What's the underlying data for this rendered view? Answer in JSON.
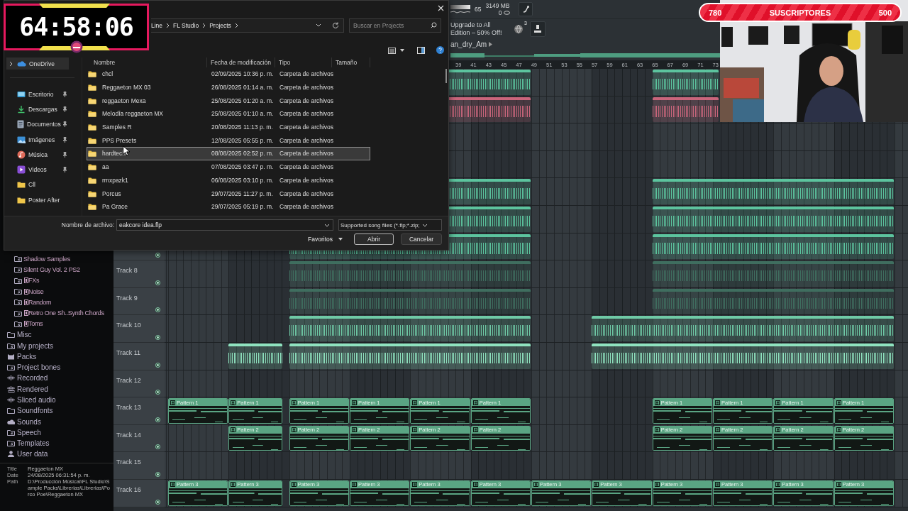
{
  "timer": {
    "time": "64:58:06"
  },
  "subscriber_goal": {
    "left_count": "780",
    "label": "SUSCRIPTORES",
    "right_count": "500"
  },
  "toolbar": {
    "cpu": "65",
    "memory": "3149 MB",
    "polyphony": "0",
    "upgrade_notice": "Upgrade to All Edition – 50% Off!",
    "notification_count": "3",
    "pattern": "an_dry_Am"
  },
  "ruler": [
    "39",
    "41",
    "43",
    "45",
    "47",
    "49",
    "51",
    "53",
    "55",
    "57",
    "59",
    "61",
    "63",
    "65",
    "67",
    "69",
    "71",
    "73"
  ],
  "tracks": [
    {
      "color": "#5cc49e",
      "clips": [
        {
          "kind": "audio"
        },
        {
          "kind": "audio"
        }
      ]
    },
    {
      "color": "#c9657b",
      "clips": [
        {
          "kind": "audio"
        },
        {
          "kind": "audio"
        }
      ]
    },
    {
      "color": "#5cc49e",
      "clips": [
        {
          "kind": "audio"
        },
        {
          "kind": "audio"
        }
      ]
    },
    {
      "color": "#5cc49e",
      "clips": [
        {
          "kind": "audio"
        },
        {
          "kind": "audio"
        }
      ]
    },
    {
      "color": "#5cc49e",
      "clips": [
        {
          "kind": "audio"
        },
        {
          "kind": "audio"
        }
      ]
    },
    {
      "name": "Track 8",
      "color": "#3f6e5f",
      "clips": [
        {
          "kind": "audio"
        },
        {
          "kind": "audio"
        }
      ]
    },
    {
      "name": "Track 9",
      "color": "#3f6e5f",
      "clips": [
        {
          "kind": "audio"
        },
        {
          "kind": "audio"
        }
      ]
    },
    {
      "name": "Track 10",
      "color": "#6fcaa6",
      "clips": [
        {
          "kind": "audio"
        },
        {
          "kind": "audio"
        }
      ]
    },
    {
      "name": "Track 11",
      "color": "#8fe3bf",
      "clips": [
        {
          "kind": "audio"
        },
        {
          "kind": "audio"
        },
        {
          "kind": "audio"
        }
      ]
    },
    {
      "name": "Track 12"
    },
    {
      "name": "Track 13",
      "color": "#5aa583",
      "clips": [
        {
          "kind": "pattern",
          "label": "Pattern 1"
        },
        {
          "kind": "pattern",
          "label": "Pattern 1"
        },
        {
          "kind": "pattern",
          "label": "Pattern 1"
        },
        {
          "kind": "pattern",
          "label": "Pattern 1"
        },
        {
          "kind": "pattern",
          "label": "Pattern 1"
        },
        {
          "kind": "pattern",
          "label": "Pattern 1"
        },
        {
          "kind": "pattern",
          "label": "Pattern 1"
        },
        {
          "kind": "pattern",
          "label": "Pattern 1"
        },
        {
          "kind": "pattern",
          "label": "Pattern 1"
        },
        {
          "kind": "pattern",
          "label": "Pattern 1"
        }
      ]
    },
    {
      "name": "Track 14",
      "color": "#5aa583",
      "clips": [
        {
          "kind": "pattern",
          "label": "Pattern 2"
        },
        {
          "kind": "pattern",
          "label": "Pattern 2"
        },
        {
          "kind": "pattern",
          "label": "Pattern 2"
        },
        {
          "kind": "pattern",
          "label": "Pattern 2"
        },
        {
          "kind": "pattern",
          "label": "Pattern 2"
        },
        {
          "kind": "pattern",
          "label": "Pattern 2"
        },
        {
          "kind": "pattern",
          "label": "Pattern 2"
        },
        {
          "kind": "pattern",
          "label": "Pattern 2"
        },
        {
          "kind": "pattern",
          "label": "Pattern 2"
        }
      ]
    },
    {
      "name": "Track 15"
    },
    {
      "name": "Track 16",
      "color": "#5aa583",
      "clips": [
        {
          "kind": "pattern",
          "label": "Pattern 3"
        },
        {
          "kind": "pattern",
          "label": "Pattern 3"
        },
        {
          "kind": "pattern",
          "label": "Pattern 3"
        },
        {
          "kind": "pattern",
          "label": "Pattern 3"
        },
        {
          "kind": "pattern",
          "label": "Pattern 3"
        },
        {
          "kind": "pattern",
          "label": "Pattern 3"
        },
        {
          "kind": "pattern",
          "label": "Pattern 3"
        },
        {
          "kind": "pattern",
          "label": "Pattern 3"
        },
        {
          "kind": "pattern",
          "label": "Pattern 3"
        },
        {
          "kind": "pattern",
          "label": "Pattern 3"
        },
        {
          "kind": "pattern",
          "label": "Pattern 3"
        },
        {
          "kind": "pattern",
          "label": "Pattern 3"
        }
      ]
    }
  ],
  "browser": {
    "items": [
      {
        "children": [
          {
            "label": "Shadow Samples",
            "kind": "link-folder"
          },
          {
            "label": "Silent Guy Vol. 2 PS2",
            "kind": "link-folder"
          },
          {
            "label": "FXs",
            "kind": "boxed-folder"
          },
          {
            "label": "Noise",
            "kind": "boxed-folder"
          },
          {
            "label": "Random",
            "kind": "boxed-folder"
          },
          {
            "label": "Retro One Sh..Synth Chords",
            "kind": "boxed-folder"
          },
          {
            "label": "Toms",
            "kind": "boxed-folder"
          }
        ]
      },
      {
        "label": "Misc",
        "kind": "folder"
      },
      {
        "label": "My projects",
        "kind": "link-folder"
      },
      {
        "label": "Packs",
        "kind": "pack"
      },
      {
        "label": "Project bones",
        "kind": "link-folder"
      },
      {
        "label": "Recorded",
        "kind": "audio"
      },
      {
        "label": "Rendered",
        "kind": "rendered"
      },
      {
        "label": "Sliced audio",
        "kind": "audio"
      },
      {
        "label": "Soundfonts",
        "kind": "folder"
      },
      {
        "label": "Sounds",
        "kind": "cloud"
      },
      {
        "label": "Speech",
        "kind": "link-folder"
      },
      {
        "label": "Templates",
        "kind": "link-folder"
      },
      {
        "label": "User data",
        "kind": "user"
      }
    ],
    "info": [
      {
        "label": "Title",
        "value": "Reggaeton MX"
      },
      {
        "label": "Date",
        "value": "24/08/2025 06:31:54 p. m."
      },
      {
        "label": "Path",
        "value": "D:\\Producción Músical\\FL Studio\\Sample Packs\\Librerias\\Librerias\\Porco Poe\\Reggaeton MX"
      }
    ]
  },
  "dialog": {
    "breadcrumb": [
      "Line",
      "FL Studio",
      "Projects"
    ],
    "search": {
      "placeholder": "Buscar en Projects"
    },
    "nav": [
      {
        "label": "OneDrive",
        "kind": "cloud",
        "selected": true,
        "pinned": false
      },
      {
        "label": "Escritorio",
        "kind": "desktop",
        "selected": false,
        "pinned": true
      },
      {
        "label": "Descargas",
        "kind": "downloads",
        "selected": false,
        "pinned": true
      },
      {
        "label": "Documentos",
        "kind": "documents",
        "selected": false,
        "pinned": true
      },
      {
        "label": "Imágenes",
        "kind": "pictures",
        "selected": false,
        "pinned": true
      },
      {
        "label": "Música",
        "kind": "music",
        "selected": false,
        "pinned": true
      },
      {
        "label": "Videos",
        "kind": "videos",
        "selected": false,
        "pinned": true
      },
      {
        "label": "Cll",
        "kind": "folder",
        "selected": false,
        "pinned": false
      },
      {
        "label": "Poster After",
        "kind": "folder",
        "selected": false,
        "pinned": false
      }
    ],
    "columns": [
      "Nombre",
      "Fecha de modificación",
      "Tipo",
      "Tamaño"
    ],
    "files": [
      {
        "name": "chcl",
        "date": "02/09/2025 10:36 p. m.",
        "type": "Carpeta de archivos",
        "selected": false
      },
      {
        "name": "Reggaeton MX 03",
        "date": "26/08/2025 01:14 a. m.",
        "type": "Carpeta de archivos",
        "selected": false
      },
      {
        "name": "reggaeton Mexa",
        "date": "25/08/2025 01:20 a. m.",
        "type": "Carpeta de archivos",
        "selected": false
      },
      {
        "name": "Melodía reggaeton MX",
        "date": "25/08/2025 01:10 a. m.",
        "type": "Carpeta de archivos",
        "selected": false
      },
      {
        "name": "Samples R",
        "date": "20/08/2025 11:13 p. m.",
        "type": "Carpeta de archivos",
        "selected": false
      },
      {
        "name": "PPS Presets",
        "date": "12/08/2025 05:55 p. m.",
        "type": "Carpeta de archivos",
        "selected": false
      },
      {
        "name": "hardtech",
        "date": "08/08/2025 02:52 p. m.",
        "type": "Carpeta de archivos",
        "selected": true
      },
      {
        "name": "aa",
        "date": "07/08/2025 03:47 p. m.",
        "type": "Carpeta de archivos",
        "selected": false
      },
      {
        "name": "rmxpazk1",
        "date": "06/08/2025 03:10 p. m.",
        "type": "Carpeta de archivos",
        "selected": false
      },
      {
        "name": "Porcus",
        "date": "29/07/2025 11:27 p. m.",
        "type": "Carpeta de archivos",
        "selected": false
      },
      {
        "name": "Pa Grace",
        "date": "29/07/2025 05:19 p. m.",
        "type": "Carpeta de archivos",
        "selected": false
      }
    ],
    "filename": {
      "label": "Nombre de archivo:",
      "value": "eakcore idea.flp"
    },
    "filter": "Supported song files (*.flp;*.zip;",
    "buttons": [
      {
        "label": "Favoritos",
        "kind": "menu"
      },
      {
        "label": "Abrir",
        "kind": "default"
      },
      {
        "label": "Cancelar",
        "kind": "plain"
      }
    ]
  }
}
